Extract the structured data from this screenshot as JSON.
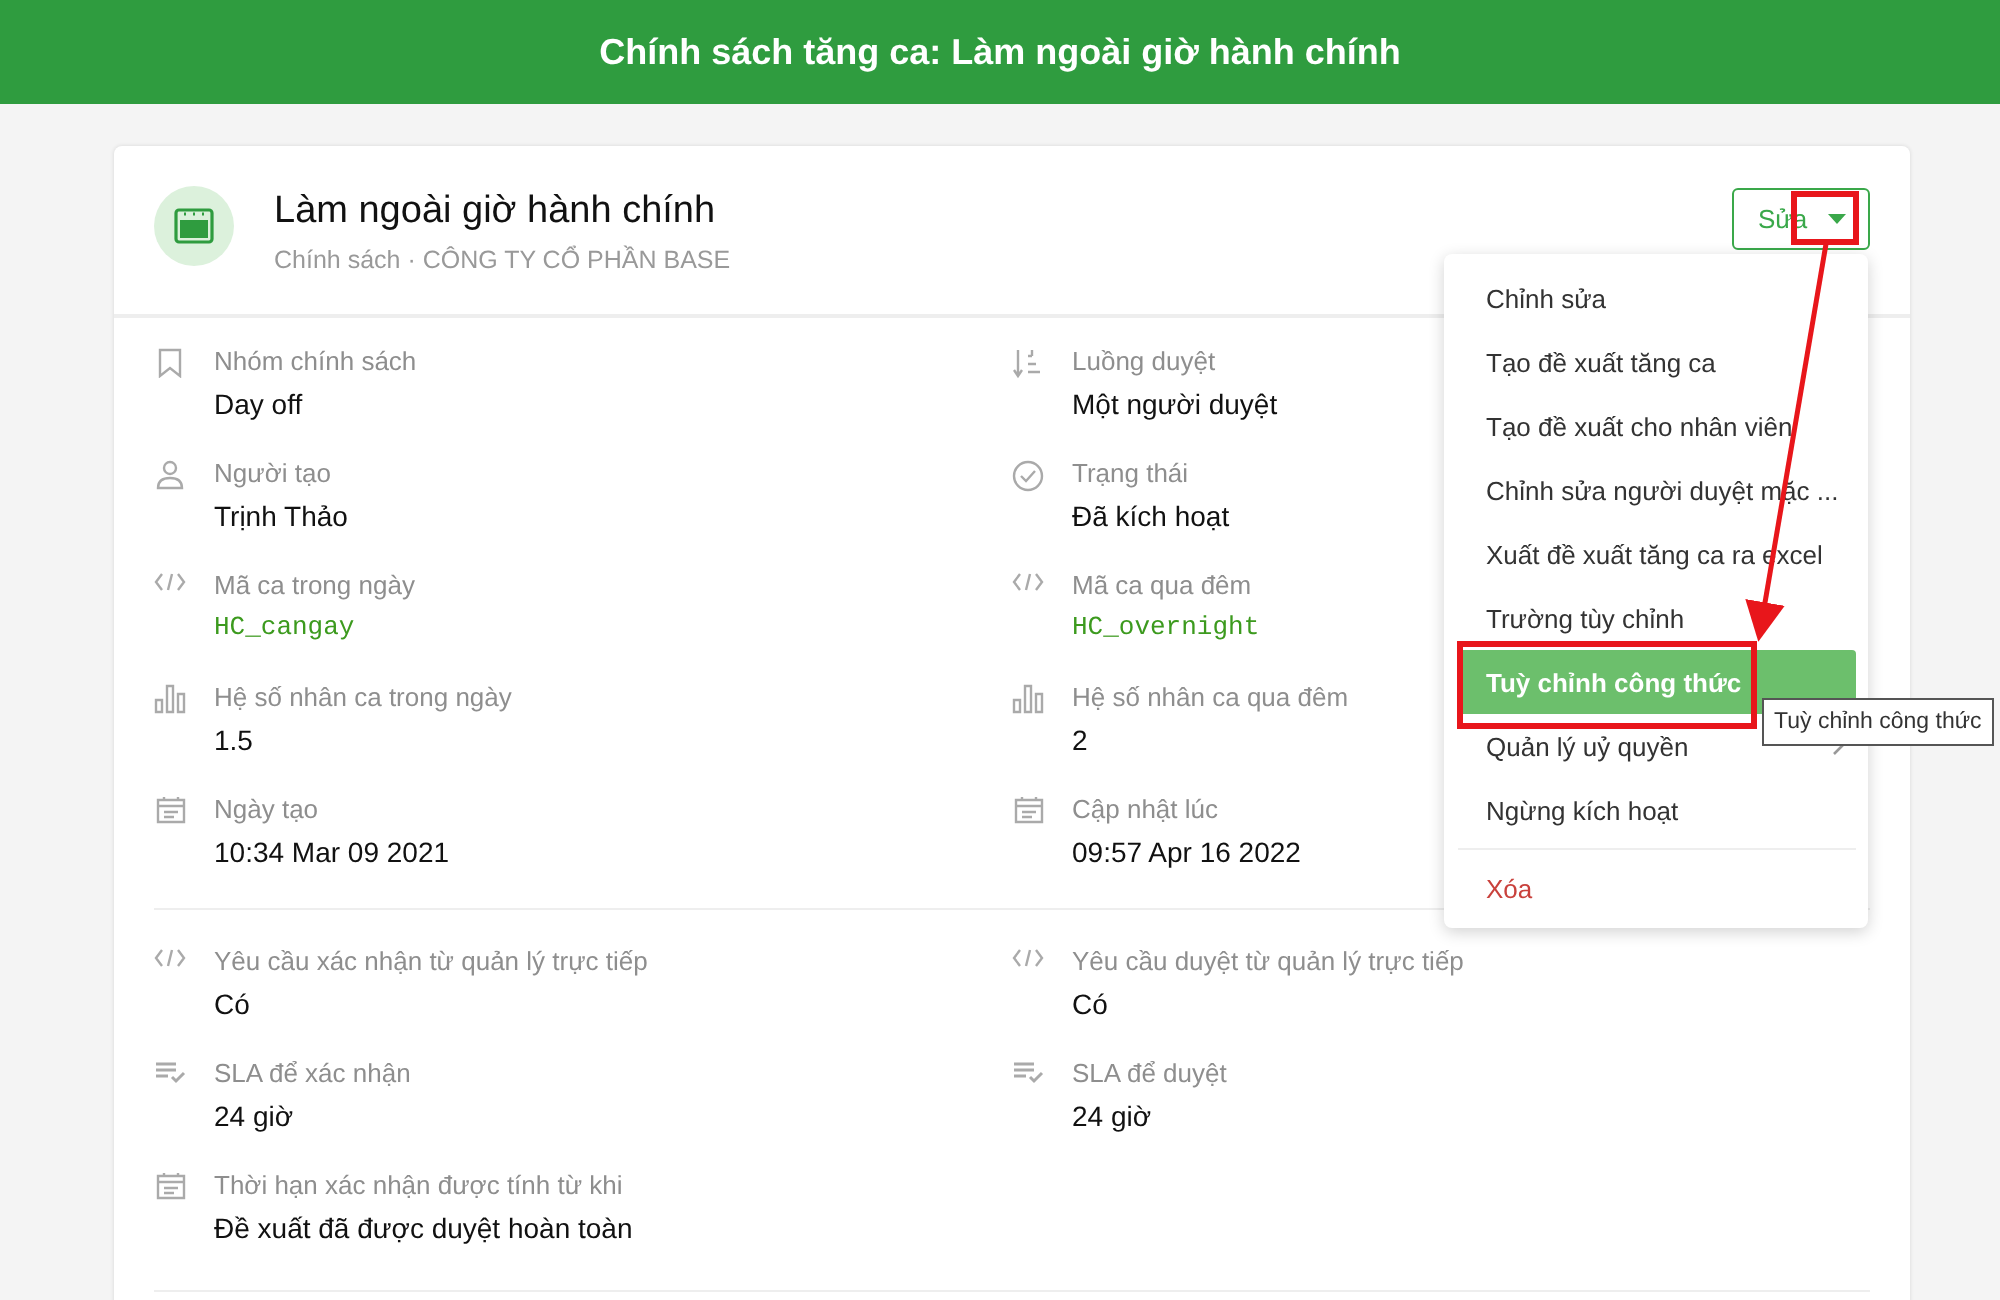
{
  "header": {
    "title": "Chính sách tăng ca: Làm ngoài giờ hành chính"
  },
  "policy": {
    "title": "Làm ngoài giờ hành chính",
    "subtitle": "Chính sách · CÔNG TY CỔ PHẦN BASE"
  },
  "edit_button": {
    "label": "Sửa"
  },
  "details": [
    {
      "label": "Nhóm chính sách",
      "value": "Day off",
      "kind": "text"
    },
    {
      "label": "Luồng duyệt",
      "value": "Một người duyệt",
      "kind": "text"
    },
    {
      "label": "Người tạo",
      "value": "Trịnh Thảo",
      "kind": "text"
    },
    {
      "label": "Trạng thái",
      "value": "Đã kích hoạt",
      "kind": "text"
    },
    {
      "label": "Mã ca trong ngày",
      "value": "HC_cangay",
      "kind": "code"
    },
    {
      "label": "Mã ca qua đêm",
      "value": "HC_overnight",
      "kind": "code"
    },
    {
      "label": "Hệ số nhân ca trong ngày",
      "value": "1.5",
      "kind": "text"
    },
    {
      "label": "Hệ số nhân ca qua đêm",
      "value": "2",
      "kind": "text"
    },
    {
      "label": "Ngày tạo",
      "value": "10:34 Mar 09 2021",
      "kind": "text"
    },
    {
      "label": "Cập nhật lúc",
      "value": "09:57 Apr 16 2022",
      "kind": "text"
    }
  ],
  "details_2": [
    {
      "label": "Yêu cầu xác nhận từ quản lý trực tiếp",
      "value": "Có"
    },
    {
      "label": "Yêu cầu duyệt từ quản lý trực tiếp",
      "value": "Có"
    },
    {
      "label": "SLA để xác nhận",
      "value": "24 giờ"
    },
    {
      "label": "SLA để duyệt",
      "value": "24 giờ"
    },
    {
      "label": "Thời hạn xác nhận được tính từ khi",
      "value": "Đề xuất đã được duyệt hoàn toàn"
    }
  ],
  "menu": {
    "items": [
      {
        "label": "Chỉnh sửa",
        "selected": false,
        "kind": "normal"
      },
      {
        "label": "Tạo đề xuất tăng ca",
        "selected": false,
        "kind": "normal"
      },
      {
        "label": "Tạo đề xuất cho nhân viên",
        "selected": false,
        "kind": "normal"
      },
      {
        "label": "Chỉnh sửa người duyệt mặc ...",
        "selected": false,
        "kind": "normal"
      },
      {
        "label": "Xuất đề xuất tăng ca ra excel",
        "selected": false,
        "kind": "normal"
      },
      {
        "label": "Trường tùy chỉnh",
        "selected": false,
        "kind": "normal"
      },
      {
        "label": "Tuỳ chỉnh công thức",
        "selected": true,
        "kind": "normal"
      },
      {
        "label": "Quản lý uỷ quyền",
        "selected": false,
        "kind": "submenu"
      },
      {
        "label": "Ngừng kích hoạt",
        "selected": false,
        "kind": "normal"
      },
      {
        "label": "Xóa",
        "selected": false,
        "kind": "danger"
      }
    ]
  },
  "tooltip": {
    "text": "Tuỳ chỉnh công thức"
  }
}
